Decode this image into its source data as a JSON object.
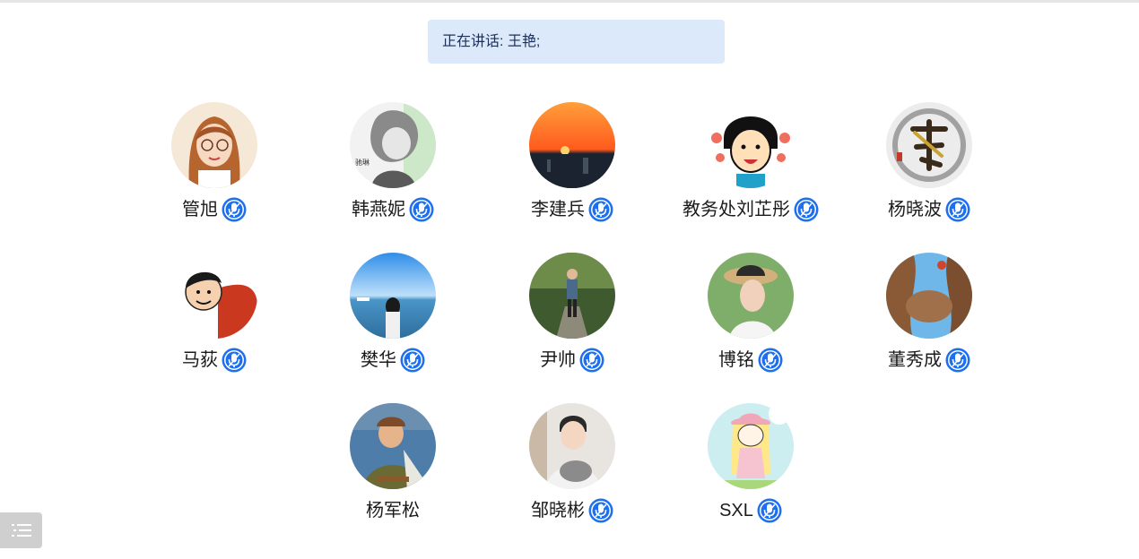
{
  "speaking": {
    "text": "正在讲话: 王艳;"
  },
  "participants": [
    {
      "name": "管旭",
      "mic": true,
      "avatar_icon": "cartoon-girl-avatar"
    },
    {
      "name": "韩燕妮",
      "mic": true,
      "avatar_icon": "sketch-girl-avatar"
    },
    {
      "name": "李建兵",
      "mic": true,
      "avatar_icon": "sunset-avatar"
    },
    {
      "name": "教务处刘芷彤",
      "mic": true,
      "avatar_icon": "cartoon-face-avatar"
    },
    {
      "name": "杨晓波",
      "mic": true,
      "avatar_icon": "calligraphy-avatar"
    },
    {
      "name": "马荻",
      "mic": true,
      "avatar_icon": "cartoon-boy-avatar"
    },
    {
      "name": "樊华",
      "mic": true,
      "avatar_icon": "beach-avatar"
    },
    {
      "name": "尹帅",
      "mic": true,
      "avatar_icon": "park-photo-avatar"
    },
    {
      "name": "博铭",
      "mic": true,
      "avatar_icon": "hat-photo-avatar"
    },
    {
      "name": "董秀成",
      "mic": true,
      "avatar_icon": "rock-avatar"
    },
    {
      "name": "杨军松",
      "mic": false,
      "avatar_icon": "poster-avatar"
    },
    {
      "name": "邹晓彬",
      "mic": true,
      "avatar_icon": "boy-cat-avatar"
    },
    {
      "name": "SXL",
      "mic": true,
      "avatar_icon": "cartoon-hat-avatar"
    }
  ],
  "menu": {
    "icon": "list-menu-icon"
  },
  "colors": {
    "mic_blue": "#1e6ff0",
    "banner_bg": "#dbe9fb",
    "banner_text": "#1a2f5a"
  }
}
